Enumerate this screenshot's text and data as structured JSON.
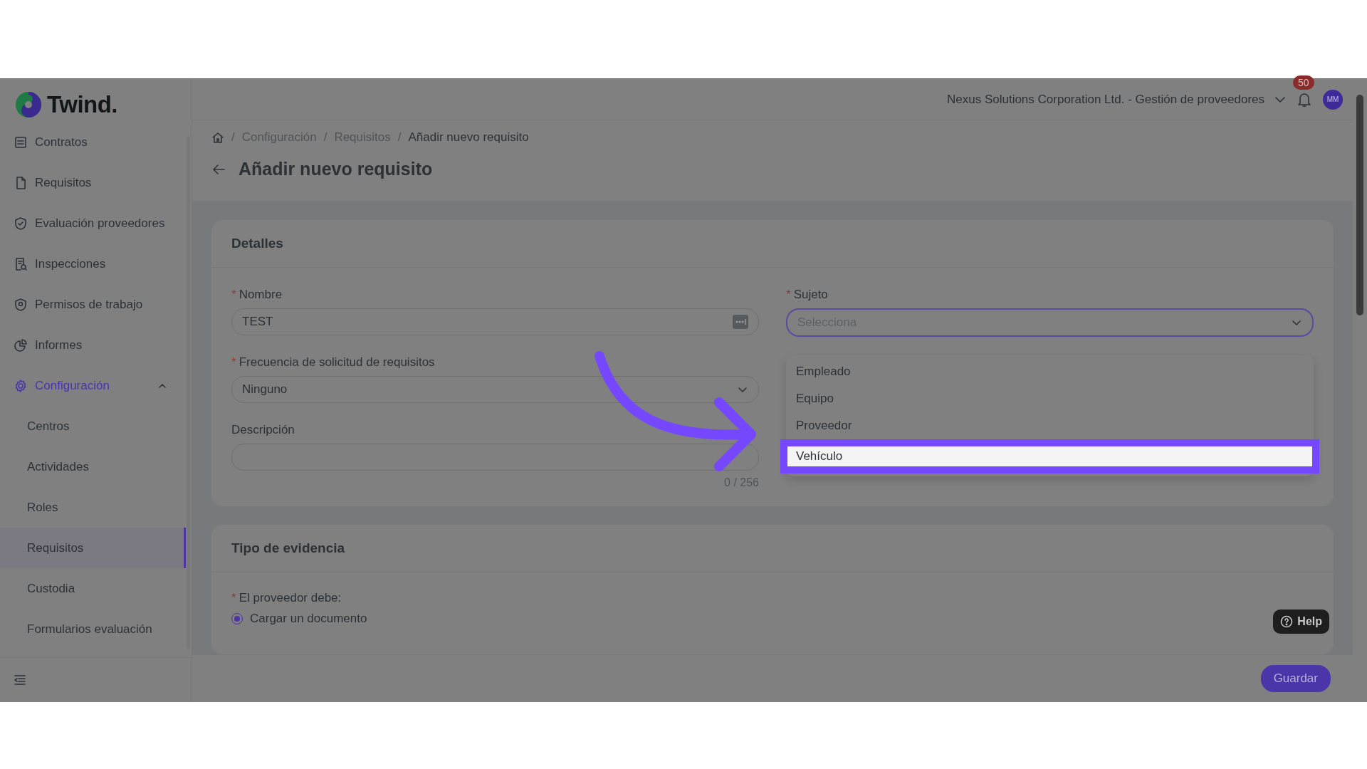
{
  "logo": {
    "text": "Twind."
  },
  "sidebar": {
    "items": [
      {
        "label": "Contratos",
        "selected": false
      },
      {
        "label": "Requisitos",
        "selected": false
      },
      {
        "label": "Evaluación proveedores",
        "selected": false
      },
      {
        "label": "Inspecciones",
        "selected": false
      },
      {
        "label": "Permisos de trabajo",
        "selected": false
      },
      {
        "label": "Informes",
        "selected": false
      },
      {
        "label": "Configuración",
        "selected": true,
        "expanded": true,
        "children": [
          {
            "label": "Centros",
            "selected": false
          },
          {
            "label": "Actividades",
            "selected": false
          },
          {
            "label": "Roles",
            "selected": false
          },
          {
            "label": "Requisitos",
            "selected": true
          },
          {
            "label": "Custodia",
            "selected": false
          },
          {
            "label": "Formularios evaluación",
            "selected": false
          }
        ]
      }
    ]
  },
  "header": {
    "organization": "Nexus Solutions Corporation Ltd. - Gestión de proveedores",
    "notifications": "50",
    "avatar": "MM"
  },
  "breadcrumb": {
    "separators": [
      "/",
      "/",
      "/"
    ],
    "items": [
      "Configuración",
      "Requisitos",
      "Añadir nuevo requisito"
    ]
  },
  "title": "Añadir nuevo requisito",
  "details": {
    "title": "Detalles",
    "left_fields": [
      {
        "kind": "text",
        "label": "Nombre",
        "required_mark": "*",
        "value": "TEST"
      },
      {
        "kind": "select",
        "label": "Frecuencia de solicitud de requisitos",
        "required_mark": "*",
        "value": "Ninguno"
      },
      {
        "kind": "textarea",
        "label": "Descripción",
        "counter": "0 / 256"
      }
    ],
    "subject": {
      "label": "Sujeto",
      "required_mark": "*",
      "placeholder": "Selecciona",
      "expanded": true,
      "options": [
        {
          "label": "Empleado",
          "highlighted": false
        },
        {
          "label": "Equipo",
          "highlighted": false
        },
        {
          "label": "Proveedor",
          "highlighted": false
        },
        {
          "label": "Vehículo",
          "highlighted": true
        }
      ]
    }
  },
  "evidence": {
    "title": "Tipo de evidencia",
    "label": "El proveedor debe:",
    "required_mark": "*",
    "options": [
      {
        "label": "Cargar un documento",
        "selected": true
      }
    ]
  },
  "help": "Help",
  "save": "Guardar"
}
